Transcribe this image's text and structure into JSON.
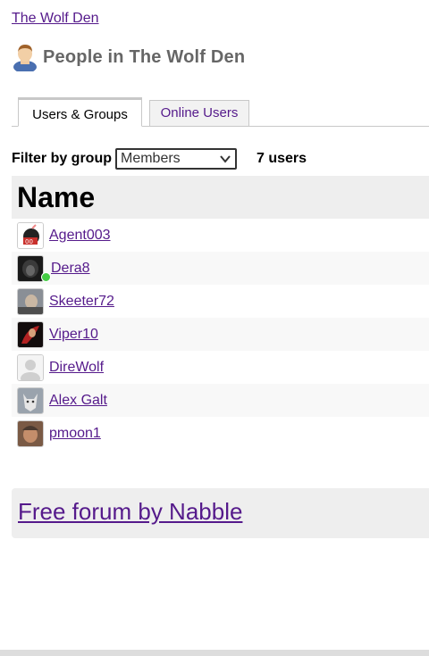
{
  "breadcrumb": {
    "forum_link": "The Wolf Den"
  },
  "header": {
    "title": "People in The Wolf Den",
    "icon": "person-icon"
  },
  "tabs": [
    {
      "label": "Users & Groups",
      "active": true
    },
    {
      "label": "Online Users",
      "active": false
    }
  ],
  "filter": {
    "label": "Filter by group",
    "selected": "Members",
    "count_text": "7 users"
  },
  "table": {
    "header": "Name",
    "users": [
      {
        "name": "Agent003",
        "online": false
      },
      {
        "name": "Dera8",
        "online": true
      },
      {
        "name": "Skeeter72",
        "online": false
      },
      {
        "name": "Viper10",
        "online": false
      },
      {
        "name": "DireWolf",
        "online": false
      },
      {
        "name": "Alex Galt",
        "online": false
      },
      {
        "name": "pmoon1",
        "online": false
      }
    ]
  },
  "footer": {
    "link": "Free forum by Nabble"
  },
  "colors": {
    "link": "#551a8b",
    "header_bg": "#eeeeee",
    "online": "#44cc44"
  }
}
